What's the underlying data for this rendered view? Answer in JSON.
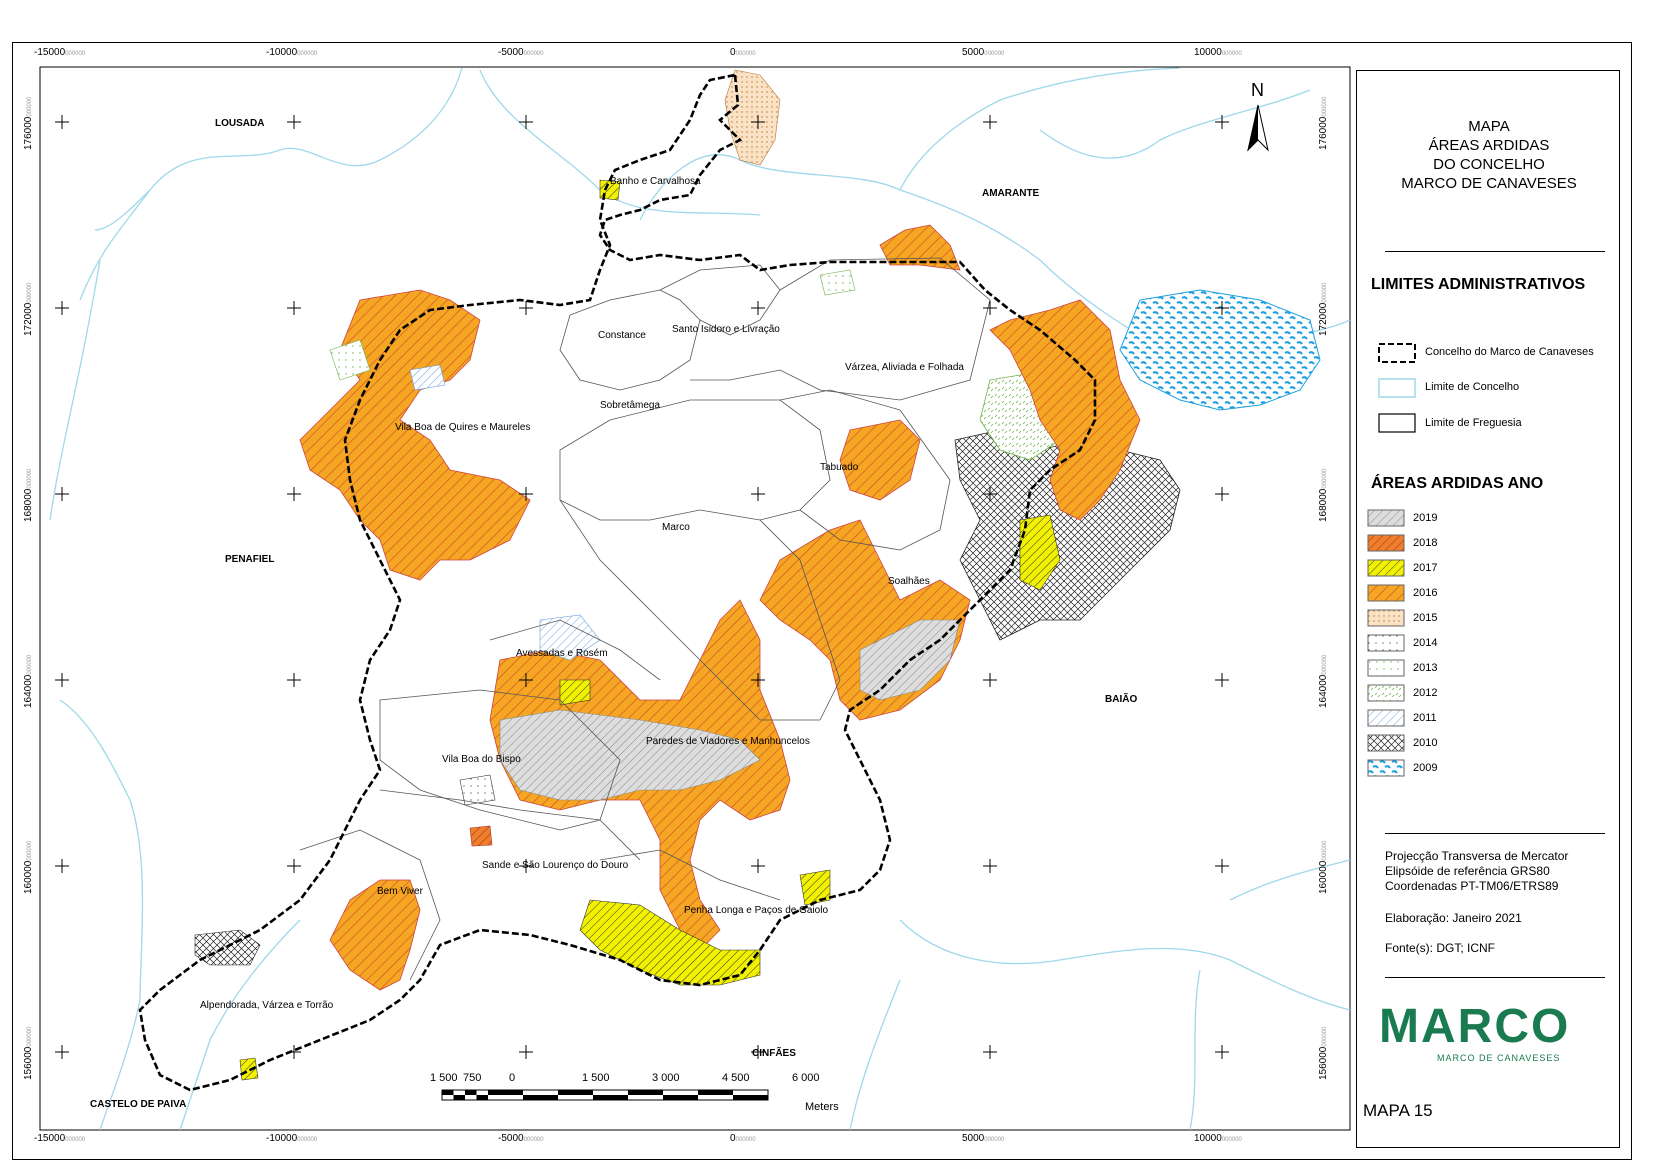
{
  "map": {
    "place_labels": [
      "LOUSADA",
      "AMARANTE",
      "PENAFIEL",
      "BAIÃO",
      "CINFÃES",
      "CASTELO DE PAIVA"
    ],
    "parish_labels": [
      "Banho e Carvalhosa",
      "Constance",
      "Santo Isidoro e Livração",
      "Várzea, Aliviada e Folhada",
      "Sobretâmega",
      "Vila Boa de Quires e Maureles",
      "Tabuado",
      "Marco",
      "Soalhães",
      "Avessadas e Rosém",
      "Paredes de Viadores e Manhuncelos",
      "Vila Boa do Bispo",
      "Sande e São Lourenço do Douro",
      "Bem Viver",
      "Penha Longa e Paços de Gaiolo",
      "Alpendorada, Várzea e Torrão"
    ],
    "north_arrow": "N",
    "x_ticks": [
      "-15000",
      "-10000",
      "-5000",
      "0",
      "5000",
      "10000"
    ],
    "y_ticks": [
      "176000",
      "172000",
      "168000",
      "164000",
      "160000",
      "156000"
    ],
    "tick_suffix": "000000",
    "scale_bar": {
      "labels": [
        "1 500",
        "750",
        "0",
        "1 500",
        "3 000",
        "4 500",
        "6 000"
      ],
      "unit": "Meters"
    }
  },
  "panel": {
    "title_lines": [
      "MAPA",
      "ÁREAS ARDIDAS",
      "DO CONCELHO",
      "MARCO DE CANAVESES"
    ],
    "admin_title": "LIMITES ADMINISTRATIVOS",
    "admin_items": [
      "Concelho do Marco de Canaveses",
      "Limite de Concelho",
      "Limite de Freguesia"
    ],
    "burn_title": "ÁREAS ARDIDAS ANO",
    "years": [
      "2019",
      "2018",
      "2017",
      "2016",
      "2015",
      "2014",
      "2013",
      "2012",
      "2011",
      "2010",
      "2009"
    ],
    "info_lines": [
      "Projecção Transversa de Mercator",
      "Elipsóide de referência GRS80",
      "Coordenadas PT-TM06/ETRS89"
    ],
    "elaboration": "Elaboração: Janeiro 2021",
    "sources": "Fonte(s): DGT; ICNF",
    "logo_text": "MARCO",
    "logo_sub": "MARCO DE CANAVESES",
    "map_number": "MAPA 15"
  },
  "colors": {
    "orange": "#f5a623",
    "orange_hatch": "#c0392b",
    "yellow": "#f2f200",
    "river": "#9fd8ea",
    "blue2009": "#1e9fe0",
    "green2013": "#6fb34a",
    "logo_green": "#1a7a50",
    "logo_teal": "#3fbfae"
  }
}
